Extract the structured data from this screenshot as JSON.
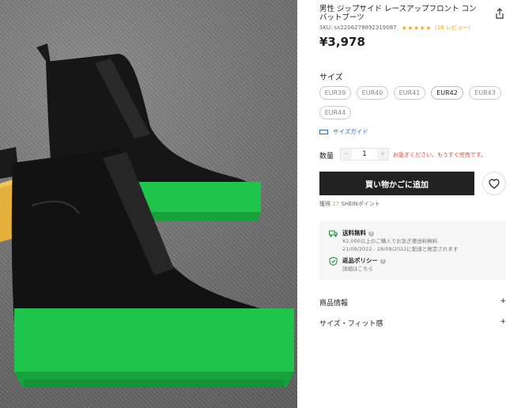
{
  "product": {
    "title": "男性 ジップサイド レースアップフロント コンバットブーツ",
    "sku": "SKU: sx2206278892319087",
    "stars": "★★★★★",
    "reviews": "(16 レビュー)",
    "price": "¥3,978"
  },
  "sizes": {
    "label": "サイズ",
    "options": [
      "EUR39",
      "EUR40",
      "EUR41",
      "EUR42",
      "EUR43",
      "EUR44"
    ],
    "selected": "EUR42",
    "guide_label": "サイズガイド"
  },
  "quantity": {
    "label": "数量",
    "minus": "−",
    "value": "1",
    "plus": "+",
    "stock_note": "お急ぎください。もうすぐ完売です。"
  },
  "actions": {
    "add_to_cart": "買い物かごに追加"
  },
  "points": {
    "prefix": "獲得",
    "count": "27",
    "suffix": "SHEINポイント"
  },
  "shipping": {
    "title": "送料無料",
    "line1": "¥2,000以上のご購入でお急ぎ便送料無料",
    "line2": "21/09/2022 - 28/09/2022に配達と推定されます"
  },
  "returns": {
    "title": "返品ポリシー",
    "line1": "詳細はこちら"
  },
  "accordion": [
    {
      "label": "商品情報",
      "toggle": "+"
    },
    {
      "label": "サイズ・フィット感",
      "toggle": "+"
    }
  ],
  "colors": {
    "sole_green": "#1fc44a",
    "accent_orange": "#f5a623",
    "alert_red": "#e04a2f",
    "cart_black": "#222222"
  }
}
